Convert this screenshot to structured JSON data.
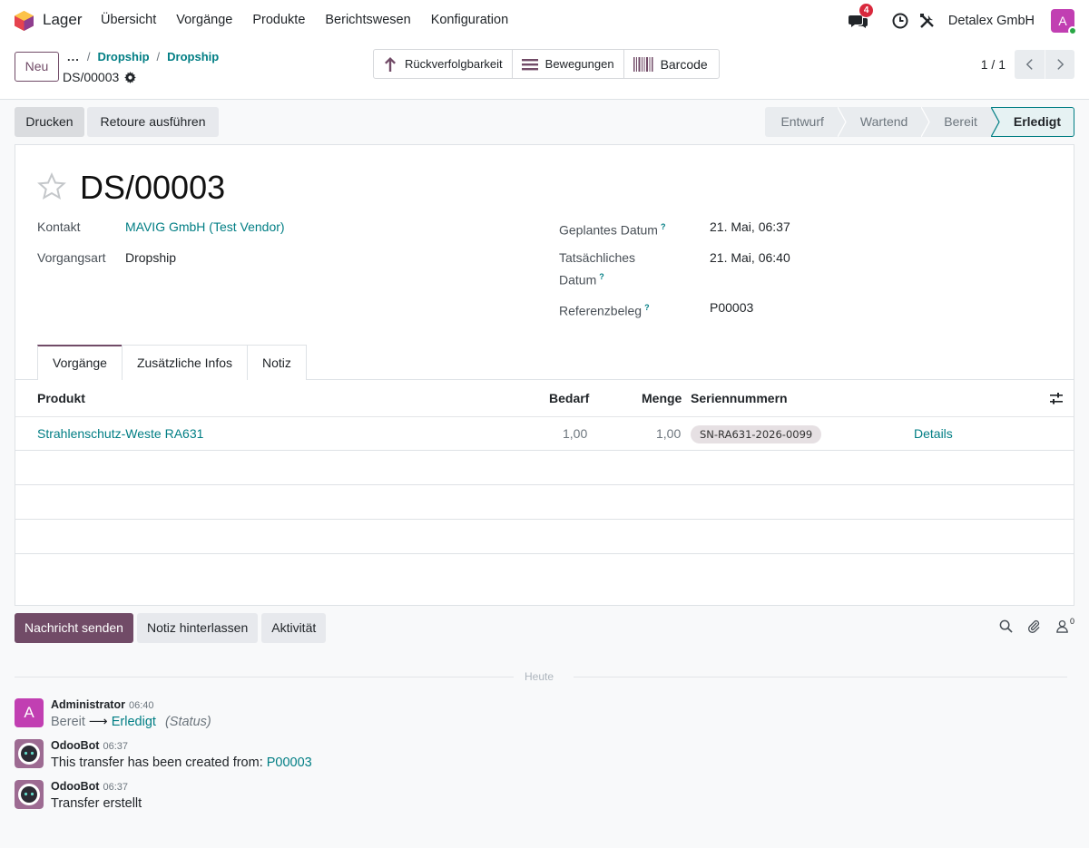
{
  "app": {
    "name": "Lager"
  },
  "menu": [
    "Übersicht",
    "Vorgänge",
    "Produkte",
    "Berichtswesen",
    "Konfiguration"
  ],
  "systray": {
    "message_count": "4",
    "company": "Detalex GmbH",
    "user_initial": "A"
  },
  "control": {
    "new_label": "Neu",
    "breadcrumb_dots": "...",
    "breadcrumb": [
      "Dropship",
      "Dropship"
    ],
    "record_name": "DS/00003",
    "smart_buttons": [
      {
        "label": "Rückverfolgbarkeit",
        "icon": "arrow-up-icon"
      },
      {
        "label": "Bewegungen",
        "icon": "list-icon"
      },
      {
        "label": "Barcode",
        "icon": "barcode-icon"
      }
    ],
    "pager": "1 / 1"
  },
  "actions": {
    "print": "Drucken",
    "return": "Retoure ausführen"
  },
  "statusbar": {
    "stages": [
      "Entwurf",
      "Wartend",
      "Bereit",
      "Erledigt"
    ],
    "active": "Erledigt"
  },
  "form": {
    "title": "DS/00003",
    "fields": {
      "contact_label": "Kontakt",
      "contact_value": "MAVIG GmbH (Test Vendor)",
      "type_label": "Vorgangsart",
      "type_value": "Dropship",
      "scheduled_label": "Geplantes Datum",
      "scheduled_value": "21. Mai, 06:37",
      "actual_label_1": "Tatsächliches",
      "actual_label_2": "Datum",
      "actual_value": "21. Mai, 06:40",
      "ref_label": "Referenzbeleg",
      "ref_value": "P00003",
      "help_mark": "?"
    },
    "tabs": [
      "Vorgänge",
      "Zusätzliche Infos",
      "Notiz"
    ],
    "table": {
      "headers": {
        "product": "Produkt",
        "demand": "Bedarf",
        "quantity": "Menge",
        "serials": "Seriennummern"
      },
      "rows": [
        {
          "product": "Strahlenschutz-Weste RA631",
          "demand": "1,00",
          "quantity": "1,00",
          "serial": "SN-RA631-2026-0099",
          "details": "Details"
        }
      ]
    }
  },
  "chatter": {
    "buttons": {
      "send": "Nachricht senden",
      "note": "Notiz hinterlassen",
      "activity": "Aktivität"
    },
    "followers": "0",
    "today": "Heute",
    "messages": [
      {
        "author": "Administrator",
        "time": "06:40",
        "avatar": "A",
        "old": "Bereit",
        "arrow": "⟶",
        "new": "Erledigt",
        "field": "(Status)"
      },
      {
        "author": "OdooBot",
        "time": "06:37",
        "text": "This transfer has been created from: ",
        "link": "P00003"
      },
      {
        "author": "OdooBot",
        "time": "06:37",
        "text": "Transfer erstellt"
      }
    ]
  }
}
